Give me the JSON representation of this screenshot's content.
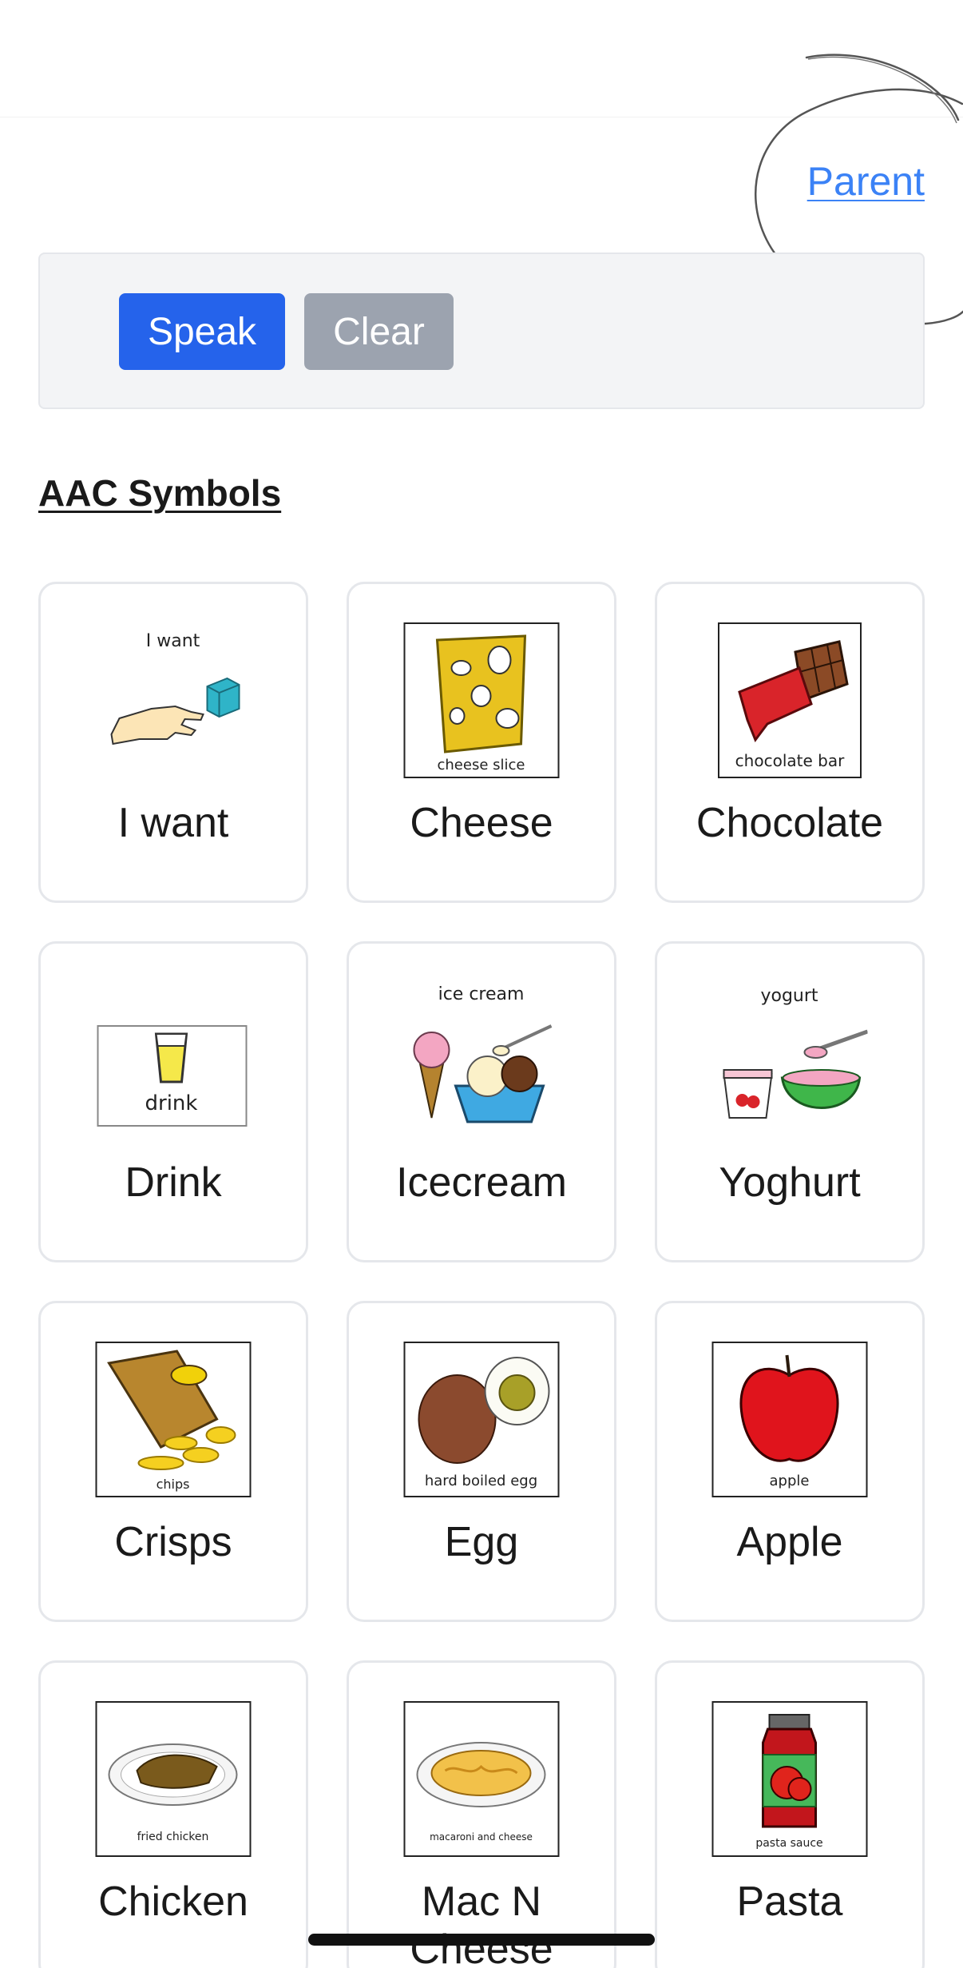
{
  "header": {
    "parent_link": "Parent"
  },
  "speech_bar": {
    "speak_label": "Speak",
    "clear_label": "Clear"
  },
  "section": {
    "title": "AAC Symbols"
  },
  "symbols": [
    {
      "label": "I want",
      "image_caption": "I want",
      "icon": "hand-reaching-cube-icon"
    },
    {
      "label": "Cheese",
      "image_caption": "cheese slice",
      "icon": "cheese-icon"
    },
    {
      "label": "Chocolate",
      "image_caption": "chocolate bar",
      "icon": "chocolate-bar-icon"
    },
    {
      "label": "Drink",
      "image_caption": "drink",
      "icon": "drink-glass-icon"
    },
    {
      "label": "Icecream",
      "image_caption": "ice cream",
      "icon": "ice-cream-icon"
    },
    {
      "label": "Yoghurt",
      "image_caption": "yogurt",
      "icon": "yogurt-icon"
    },
    {
      "label": "Crisps",
      "image_caption": "chips",
      "icon": "crisps-bag-icon"
    },
    {
      "label": "Egg",
      "image_caption": "hard boiled egg",
      "icon": "egg-icon"
    },
    {
      "label": "Apple",
      "image_caption": "apple",
      "icon": "apple-icon"
    },
    {
      "label": "Chicken",
      "image_caption": "fried chicken",
      "icon": "fried-chicken-icon"
    },
    {
      "label": "Mac N Cheese",
      "image_caption": "macaroni and cheese",
      "icon": "mac-and-cheese-icon"
    },
    {
      "label": "Pasta",
      "image_caption": "pasta sauce",
      "icon": "pasta-sauce-jar-icon"
    }
  ],
  "colors": {
    "speak_button": "#2563eb",
    "clear_button": "#9ca3af",
    "link": "#3b82f6",
    "card_border": "#e5e7eb"
  }
}
